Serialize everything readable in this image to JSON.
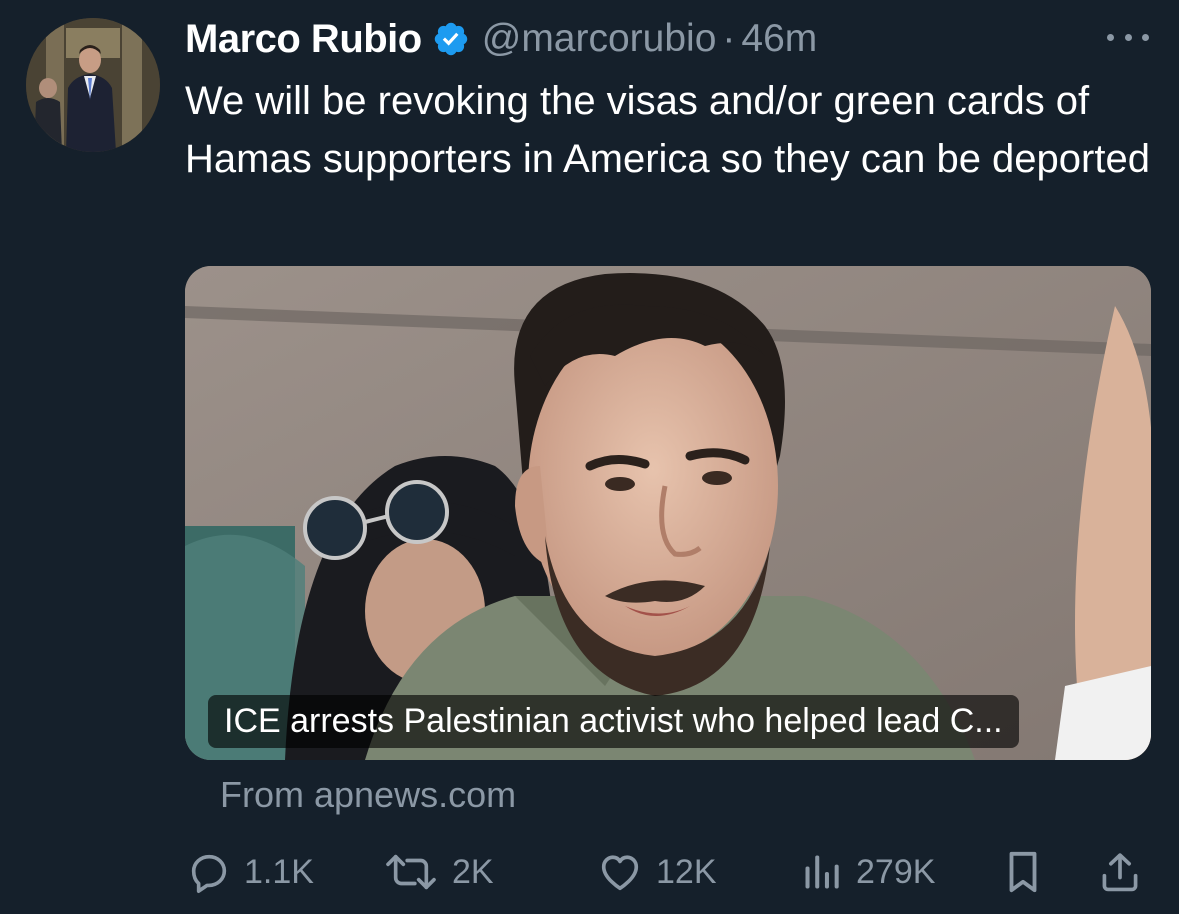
{
  "author": {
    "display_name": "Marco Rubio",
    "verified_icon": "verified-badge-icon",
    "handle": "@marcorubio",
    "separator": "·",
    "time": "46m"
  },
  "tweet": {
    "text": "We will be revoking the visas and/or green cards of Hamas supporters in America so they can be deported"
  },
  "card": {
    "title": "ICE arrests Palestinian activist who helped lead C...",
    "source": "From apnews.com"
  },
  "actions": {
    "replies": "1.1K",
    "reposts": "2K",
    "likes": "12K",
    "views": "279K"
  },
  "colors": {
    "background": "#15202b",
    "text_secondary": "#8b98a5",
    "verified": "#1d9bf0"
  }
}
